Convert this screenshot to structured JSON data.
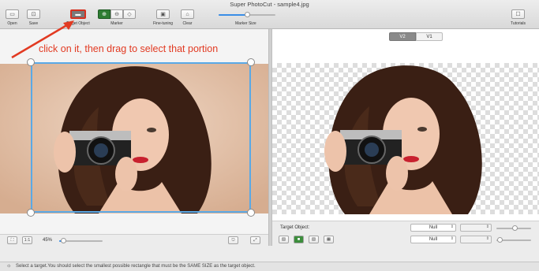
{
  "window": {
    "title": "Super PhotoCut - sample4.jpg"
  },
  "toolbar": {
    "open": "Open",
    "save": "Save",
    "target_object": "Target Object",
    "marker": "Marker",
    "fine_tuning": "Fine-tuning",
    "clear": "Clear",
    "marker_size": "Marker Size",
    "tutorials": "Tutorials",
    "marker_size_value": 0.5
  },
  "annotation": {
    "text": "click on it, then drag to select that portion",
    "color": "#e23a22"
  },
  "left_pane": {
    "zoom_fit": "⛶",
    "zoom_actual": "1:1",
    "zoom_percent": "45%",
    "zoom_value": 0.1
  },
  "right_pane": {
    "version_selected": "V2",
    "version_other": "V1",
    "target_object_label": "Target Object:",
    "combo1": "Null",
    "combo2": "Null"
  },
  "status": {
    "text": "Select a target.You should select the smallest possible rectangle that must be the SAME SIZE as the target object."
  },
  "colors": {
    "accent": "#3a8ee6",
    "selection": "#5aa9e6",
    "annotation_red": "#e23a22",
    "marker_green": "#2e7d32"
  }
}
